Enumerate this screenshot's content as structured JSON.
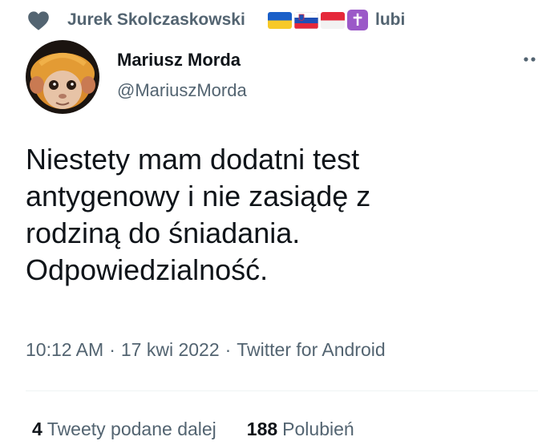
{
  "social_context": {
    "icon": "heart-icon",
    "user_name": "Jurek Skolczaskowski",
    "flags": [
      "ukraine-flag-icon",
      "slovenia-flag-icon",
      "indonesia-flag-icon",
      "cross-icon"
    ],
    "action": "lubi"
  },
  "author": {
    "name": "Mariusz Morda",
    "handle": "@MariuszMorda",
    "avatar": "monkey-avatar"
  },
  "tweet": {
    "lines": [
      "Niestety mam dodatni test",
      "antygenowy i nie zasiądę z",
      "rodziną do śniadania.",
      "Odpowiedzialność."
    ]
  },
  "meta": {
    "time": "10:12 AM",
    "date": "17 kwi 2022",
    "source": "Twitter for Android",
    "separator": "·"
  },
  "stats": {
    "retweets_count": "4",
    "retweets_label": "Tweety podane dalej",
    "likes_count": "188",
    "likes_label": "Polubień"
  },
  "colors": {
    "text_primary": "#0f1419",
    "text_secondary": "#536471",
    "divider": "#eff3f4"
  }
}
